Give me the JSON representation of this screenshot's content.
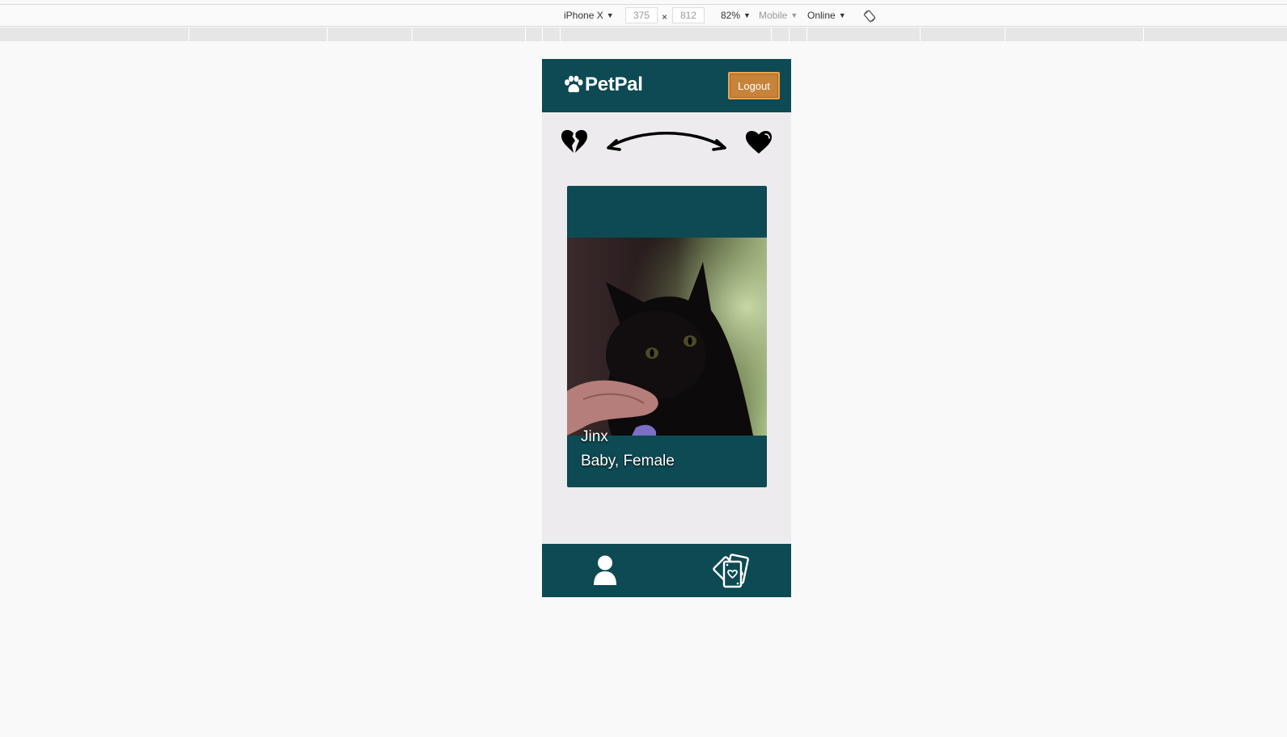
{
  "devtools": {
    "device": "iPhone X",
    "width": "375",
    "height": "812",
    "times": "×",
    "zoom": "82%",
    "mode": "Mobile",
    "network": "Online"
  },
  "app": {
    "brand": "PetPal",
    "logout_label": "Logout",
    "pet": {
      "name": "Jinx",
      "details": "Baby, Female"
    }
  },
  "colors": {
    "primary": "#0d4a53",
    "accent": "#c7833a",
    "background": "#edebee"
  },
  "icons": [
    "paw-icon",
    "broken-heart-icon",
    "double-arrow-icon",
    "heart-icon",
    "profile-icon",
    "cards-icon",
    "rotate-icon"
  ]
}
